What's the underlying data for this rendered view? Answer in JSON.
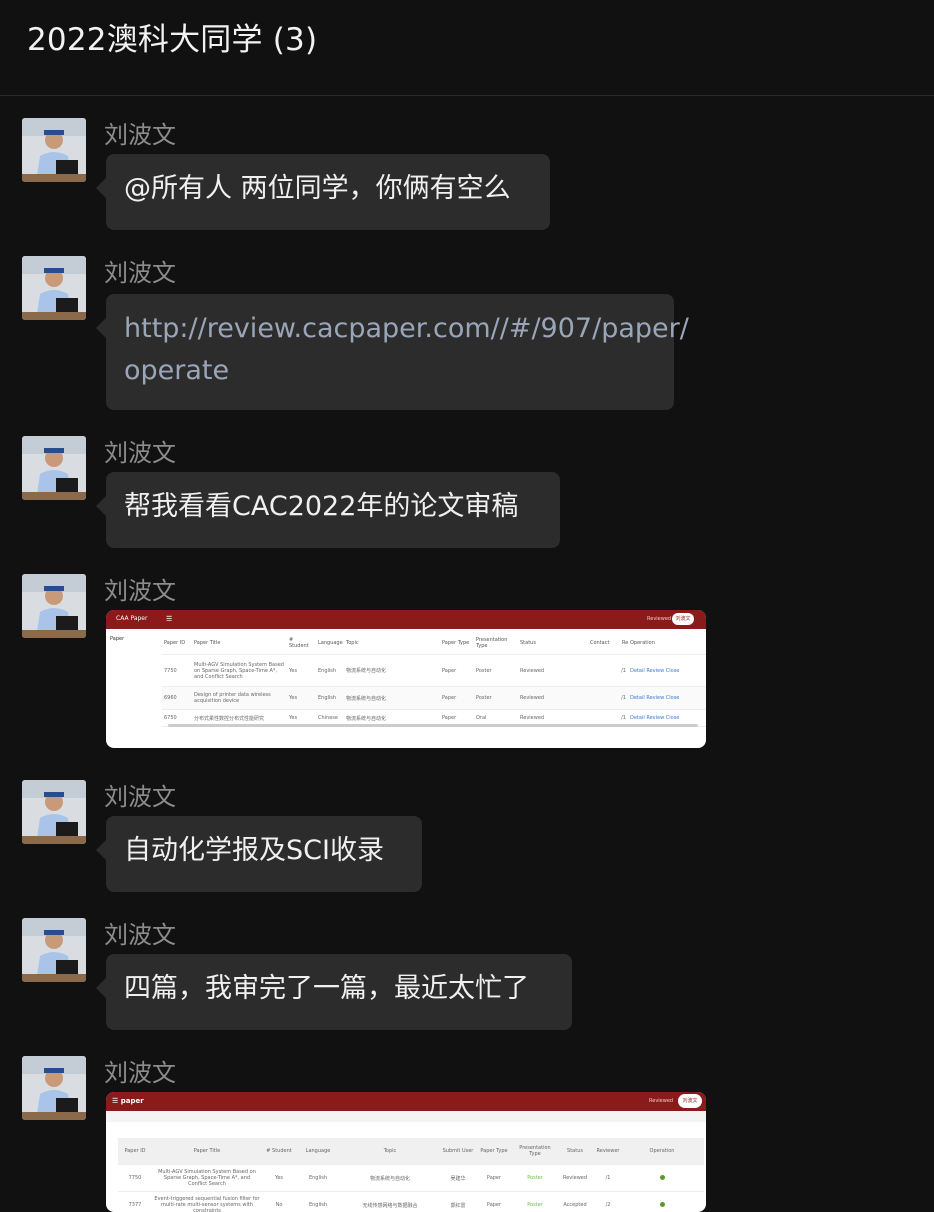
{
  "chat": {
    "title": "2022澳科大同学 (3)"
  },
  "messages": [
    {
      "sender": "刘波文",
      "type": "text",
      "text": "@所有人 两位同学，你俩有空么"
    },
    {
      "sender": "刘波文",
      "type": "link",
      "line1": "http://review.cacpaper.com//#/907/paper/",
      "line2": "operate"
    },
    {
      "sender": "刘波文",
      "type": "text",
      "text": "帮我看看CAC2022年的论文审稿"
    },
    {
      "sender": "刘波文",
      "type": "image"
    },
    {
      "sender": "刘波文",
      "type": "text",
      "text": "自动化学报及SCI收录"
    },
    {
      "sender": "刘波文",
      "type": "text",
      "text": "四篇，我审完了一篇，最近太忙了"
    },
    {
      "sender": "刘波文",
      "type": "image"
    }
  ],
  "shot1": {
    "brand": "CAA Paper",
    "reviewed": "Reviewed",
    "user": "刘波文",
    "side": "Paper",
    "headers": [
      "Paper ID",
      "Paper Title",
      "# Student",
      "Language",
      "Topic",
      "Paper Type",
      "Presentation Type",
      "Status",
      "Contact",
      "Re",
      "Operation"
    ],
    "rows": [
      [
        "7750",
        "Multi-AGV Simulation System Based on Sparse Graph, Space-Time A*, and Conflict Search",
        "Yes",
        "English",
        "物流系统与自动化",
        "Paper",
        "Poster",
        "Reviewed",
        "/1"
      ],
      [
        "6960",
        "Design of printer data wireless acquisition device",
        "Yes",
        "English",
        "物流系统与自动化",
        "Paper",
        "Poster",
        "Reviewed",
        "/1"
      ],
      [
        "6750",
        "分布式柔性数控分布式性能研究",
        "Yes",
        "Chinese",
        "物流系统与自动化",
        "Paper",
        "Oral",
        "Reviewed",
        "/1"
      ]
    ],
    "ops": [
      "Detail",
      "Review",
      "Close"
    ]
  },
  "shot2": {
    "brand": "paper",
    "reviewed": "Reviewed",
    "user": "刘波文",
    "headers": [
      "Paper ID",
      "Paper Title",
      "# Student",
      "Language",
      "Topic",
      "Submit User",
      "Paper Type",
      "Presentation Type",
      "Status",
      "Reviewer",
      "Operation"
    ],
    "rows": [
      [
        "7750",
        "Multi-AGV Simulation System Based on Sparse Graph, Space-Time A*, and Conflict Search",
        "Yes",
        "English",
        "物流系统与自动化",
        "吴建华",
        "Paper",
        "Poster",
        "Reviewed",
        "/1"
      ],
      [
        "7377",
        "Event-triggered sequential fusion filter for multi-rate multi-sensor systems with constraints",
        "No",
        "English",
        "无线传感网络与数据融合",
        "郭红雷",
        "Paper",
        "Poster",
        "Accepted",
        "/2"
      ]
    ]
  }
}
